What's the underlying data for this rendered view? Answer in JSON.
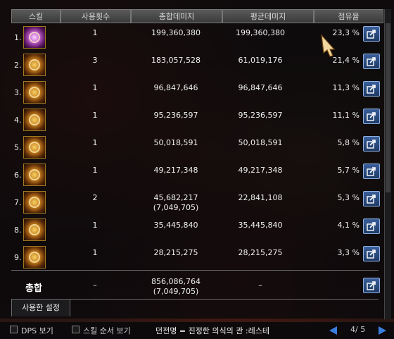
{
  "header": {
    "skill": "스킬",
    "uses": "사용횟수",
    "total_damage": "총합데미지",
    "avg_damage": "평균데미지",
    "share": "점유율"
  },
  "rows": [
    {
      "index": "1.",
      "icon": "purple-skill-icon",
      "uses": "1",
      "total": "199,360,380",
      "total_sub": "",
      "avg": "199,360,380",
      "share": "23,3 %",
      "share_fraction": 0.233
    },
    {
      "index": "2.",
      "icon": "golden-crown-skill-icon",
      "uses": "3",
      "total": "183,057,528",
      "total_sub": "",
      "avg": "61,019,176",
      "share": "21,4 %",
      "share_fraction": 0.214
    },
    {
      "index": "3.",
      "icon": "flame-fist-skill-icon",
      "uses": "1",
      "total": "96,847,646",
      "total_sub": "",
      "avg": "96,847,646",
      "share": "11,3 %",
      "share_fraction": 0.113
    },
    {
      "index": "4.",
      "icon": "target-skill-icon",
      "uses": "1",
      "total": "95,236,597",
      "total_sub": "",
      "avg": "95,236,597",
      "share": "11,1 %",
      "share_fraction": 0.111
    },
    {
      "index": "5.",
      "icon": "slash-skill-icon",
      "uses": "1",
      "total": "50,018,591",
      "total_sub": "",
      "avg": "50,018,591",
      "share": "5,8 %",
      "share_fraction": 0.058
    },
    {
      "index": "6.",
      "icon": "emblem-skill-icon",
      "uses": "1",
      "total": "49,217,348",
      "total_sub": "",
      "avg": "49,217,348",
      "share": "5,7 %",
      "share_fraction": 0.057
    },
    {
      "index": "7.",
      "icon": "spear-rush-skill-icon",
      "uses": "2",
      "total": "45,682,217",
      "total_sub": "(7,049,705)",
      "avg": "22,841,108",
      "share": "5,3 %",
      "share_fraction": 0.053
    },
    {
      "index": "8.",
      "icon": "starburst-skill-icon",
      "uses": "1",
      "total": "35,445,840",
      "total_sub": "",
      "avg": "35,445,840",
      "share": "4,1 %",
      "share_fraction": 0.041
    },
    {
      "index": "9.",
      "icon": "fire-dash-skill-icon",
      "uses": "1",
      "total": "28,215,275",
      "total_sub": "",
      "avg": "28,215,275",
      "share": "3,3 %",
      "share_fraction": 0.033
    }
  ],
  "summary": {
    "label": "총합",
    "uses": "–",
    "total": "856,086,764",
    "total_sub": "(7,049,705)",
    "avg": "–"
  },
  "tabs": {
    "settings": "사용한 설정"
  },
  "bottom": {
    "dps_view": "DPS 보기",
    "skill_order_view": "스킬 순서 보기",
    "dungeon": "던전명 = 진정한 의식의 관 :레스테",
    "page": "4/ 5"
  },
  "colors": {
    "accent": "#3a7de0",
    "export_button": "#2b4c80"
  }
}
